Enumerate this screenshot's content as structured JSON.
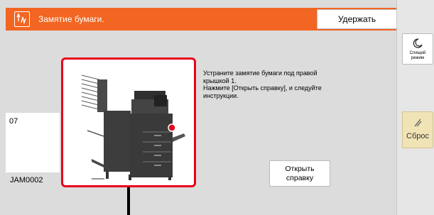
{
  "header": {
    "title": "Замятие бумаги.",
    "hold_button": "Удержать",
    "icon": "paper-jam-icon",
    "color": "#f26522"
  },
  "left_panel": {
    "number": "07",
    "job_id": "JAM0002"
  },
  "instruction": {
    "line1": "Устраните замятие бумаги под правой",
    "line2": "крышкой 1.",
    "line3": "Нажмите [Открыть справку], и следуйте",
    "line4": "инструкции."
  },
  "help_button": {
    "line1": "Открыть",
    "line2": "справку"
  },
  "side": {
    "sleep_line1": "Спящий",
    "sleep_line2": "режим",
    "sleep_icon": "moon-icon",
    "reset_label": "Сброс",
    "reset_icon": "reset-slash-icon",
    "reset_color": "#f0e3b5"
  },
  "illustration": {
    "name": "printer-illustration",
    "highlight_color": "#e8001c"
  }
}
